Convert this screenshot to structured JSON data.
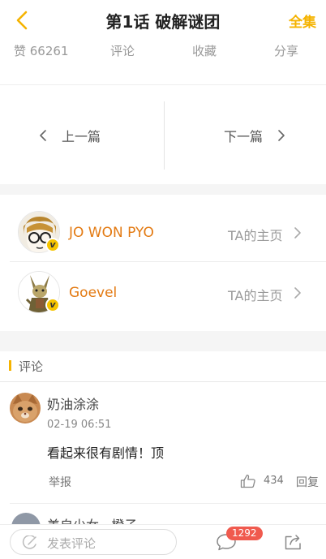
{
  "header": {
    "title": "第1话 破解谜团",
    "all_label": "全集",
    "accent": "#f5b301"
  },
  "actions": {
    "like": "赞 66261",
    "comment": "评论",
    "favorite": "收藏",
    "share": "分享"
  },
  "nav": {
    "prev": "上一篇",
    "next": "下一篇"
  },
  "authors": [
    {
      "name": "JO WON PYO",
      "home": "TA的主页",
      "badge": "v",
      "avatar": "glasses-face-avatar-icon"
    },
    {
      "name": "Goevel",
      "home": "TA的主页",
      "badge": "v",
      "avatar": "rabbit-character-avatar-icon"
    }
  ],
  "comments_section": {
    "label": "评论"
  },
  "comments": [
    {
      "user": "奶油涂涂",
      "time": "02-19 06:51",
      "text": "看起来很有剧情！顶",
      "report": "举报",
      "likes": "434",
      "reply": "回复"
    },
    {
      "user": "美自少女 · 橙子"
    }
  ],
  "bottom_bar": {
    "input_placeholder": "发表评论",
    "comment_count": "1292",
    "badge_color": "#f05a4e"
  }
}
